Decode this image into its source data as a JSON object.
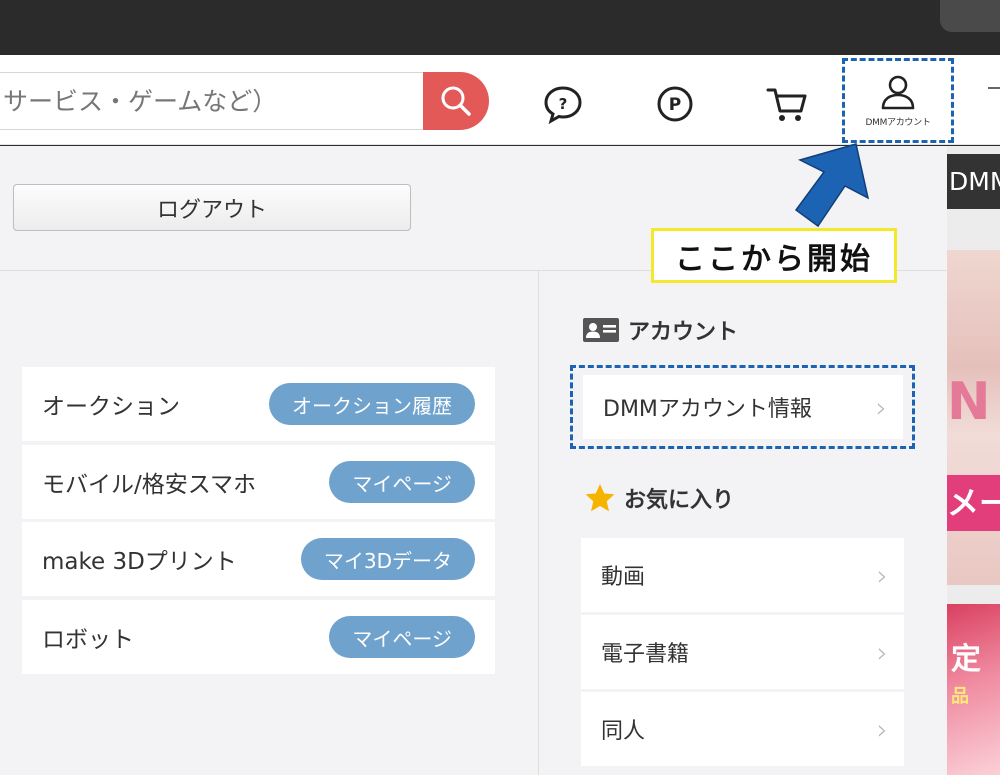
{
  "header": {
    "search_placeholder": "サービス・ゲームなど）",
    "account_label": "DMMアカウント"
  },
  "icons": {
    "search": "search-icon",
    "help": "question-bubble-icon",
    "points": "point-icon",
    "cart": "cart-icon",
    "account": "user-icon"
  },
  "panel": {
    "logout_label": "ログアウト",
    "services": [
      {
        "name": "オークション",
        "action": "オークション履歴"
      },
      {
        "name": "モバイル/格安スマホ",
        "action": "マイページ"
      },
      {
        "name": "make 3Dプリント",
        "action": "マイ3Dデータ"
      },
      {
        "name": "ロボット",
        "action": "マイページ"
      }
    ],
    "account_section": {
      "title": "アカウント",
      "item": "DMMアカウント情報"
    },
    "favorites_section": {
      "title": "お気に入り",
      "items": [
        "動画",
        "電子書籍",
        "同人"
      ]
    }
  },
  "annotation": {
    "callout": "ここから開始"
  },
  "side_banners": {
    "top_label": "DMM",
    "banner1_letter": "N",
    "banner1_band": "メー",
    "banner2_line1": "定",
    "banner2_line2": "品"
  },
  "colors": {
    "accent_blue": "#1c63b4",
    "pill_blue": "#6fa2cd",
    "search_red": "#e35958",
    "callout_border": "#f4e82a",
    "star": "#f5b400"
  }
}
